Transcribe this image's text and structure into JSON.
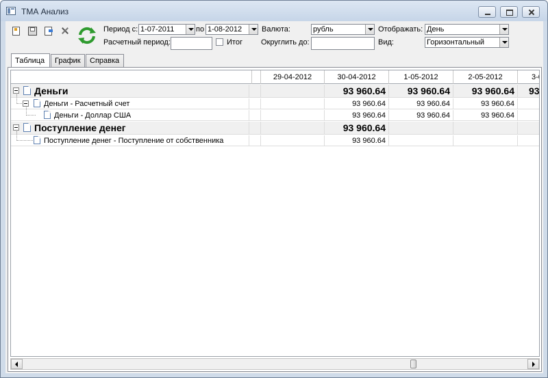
{
  "window": {
    "title": "ТМА Анализ"
  },
  "toolbar": {
    "period_from_label": "Период с:",
    "period_from_value": "1-07-2011",
    "period_to_label": "по",
    "period_to_value": "1-08-2012",
    "currency_label": "Валюта:",
    "currency_value": "рубль",
    "display_label": "Отображать:",
    "display_value": "День",
    "calc_period_label": "Расчетный период:",
    "calc_period_value": "",
    "total_label": "Итог",
    "total_checked": false,
    "round_label": "Округлить до:",
    "round_value": "",
    "view_label": "Вид:",
    "view_value": "Горизонтальный"
  },
  "tabs": [
    {
      "label": "Таблица",
      "active": true
    },
    {
      "label": "График",
      "active": false
    },
    {
      "label": "Справка",
      "active": false
    }
  ],
  "grid": {
    "columns": [
      "29-04-2012",
      "30-04-2012",
      "1-05-2012",
      "2-05-2012",
      "3-0"
    ],
    "rows": [
      {
        "label": "Деньги",
        "level": 0,
        "total": true,
        "values": [
          "",
          "93 960.64",
          "93 960.64",
          "93 960.64",
          "93"
        ]
      },
      {
        "label": "Деньги - Расчетный счет",
        "level": 1,
        "total": false,
        "values": [
          "",
          "93 960.64",
          "93 960.64",
          "93 960.64",
          ""
        ]
      },
      {
        "label": "Деньги - Доллар США",
        "level": 2,
        "total": false,
        "values": [
          "",
          "93 960.64",
          "93 960.64",
          "93 960.64",
          ""
        ]
      },
      {
        "label": "Поступление денег",
        "level": 0,
        "total": true,
        "values": [
          "",
          "93 960.64",
          "",
          "",
          ""
        ]
      },
      {
        "label": "Поступление денег - Поступление от собственника",
        "level": 1,
        "total": false,
        "values": [
          "",
          "93 960.64",
          "",
          "",
          ""
        ]
      }
    ]
  }
}
